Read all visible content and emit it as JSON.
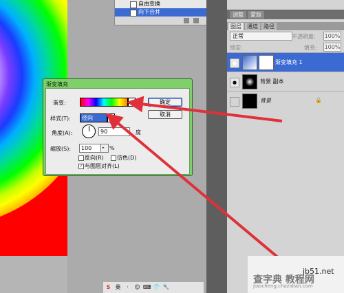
{
  "history": {
    "items": [
      {
        "label": "自由变换"
      },
      {
        "label": "向下合并"
      }
    ]
  },
  "panels": {
    "top_tabs": [
      "调整",
      "蒙版"
    ],
    "layers_tabs": [
      "图层",
      "通道",
      "路径"
    ],
    "blend_mode": "正常",
    "opacity_label": "不透明度:",
    "opacity_value": "100%",
    "lock_label": "锁定:",
    "fill_label": "填充:",
    "fill_value": "100%",
    "layers": [
      {
        "name": "渐变填充 1"
      },
      {
        "name": "背景 副本"
      },
      {
        "name": "背景"
      }
    ]
  },
  "dialog": {
    "title": "渐变填充",
    "gradient_label": "渐变:",
    "style_label": "样式(T):",
    "style_value": "径向",
    "angle_label": "角度(A):",
    "angle_value": "90",
    "angle_unit": "度",
    "scale_label": "缩放(S):",
    "scale_value": "100",
    "scale_unit": "%",
    "reverse_label": "反向(R)",
    "dither_label": "仿色(D)",
    "align_label": "与图层对齐(L)",
    "ok_label": "确定",
    "cancel_label": "取消"
  },
  "taskbar": {
    "icons": [
      "S",
      "英",
      "·",
      "☺",
      "⌨",
      "👕",
      "🔧"
    ]
  },
  "watermark": {
    "main": "查字典 教程网",
    "url": "jb51.net",
    "sub": "jiaocheng.chazidian.com"
  },
  "colors": {
    "accent": "#3a6ad2",
    "arrow": "#e0303a",
    "dialog_frame": "#7fcf6a"
  }
}
